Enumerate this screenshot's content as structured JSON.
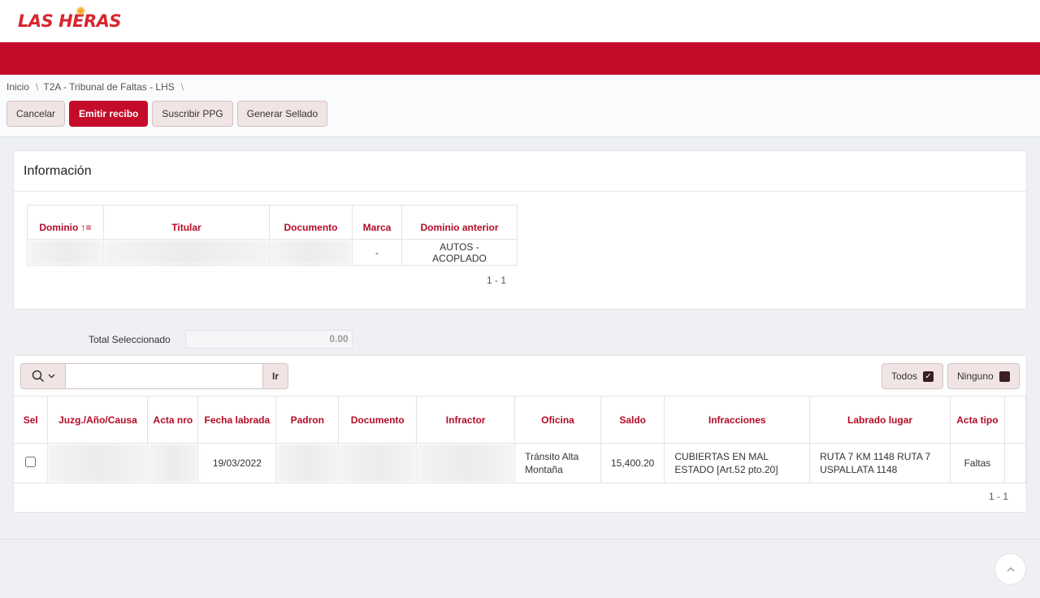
{
  "header": {
    "logo_text": "LAS HERAS",
    "brand_color": "#c40c2a"
  },
  "breadcrumb": [
    "Inicio",
    "T2A - Tribunal de Faltas - LHS"
  ],
  "breadcrumb_separator": "\\",
  "toolbar": {
    "cancel_label": "Cancelar",
    "emit_label": "Emitir recibo",
    "subscribe_label": "Suscribir PPG",
    "seal_label": "Generar Sellado"
  },
  "info": {
    "title": "Información",
    "columns": [
      "Dominio",
      "Titular",
      "Documento",
      "Marca",
      "Dominio anterior"
    ],
    "row": {
      "marca": "-",
      "dominio_anterior": "AUTOS - ACOPLADO"
    },
    "pagination": "1 - 1"
  },
  "total": {
    "label": "Total Seleccionado",
    "value": "0.00"
  },
  "grid": {
    "go_label": "Ir",
    "todos_label": "Todos",
    "ninguno_label": "Ninguno",
    "columns": {
      "sel": "Sel",
      "causa": "Juzg./Año/Causa",
      "acta_nro": "Acta nro",
      "fecha": "Fecha labrada",
      "padron": "Padron",
      "documento": "Documento",
      "infractor": "Infractor",
      "oficina": "Oficina",
      "saldo": "Saldo",
      "infracciones": "Infracciones",
      "lugar": "Labrado lugar",
      "acta_tipo": "Acta tipo"
    },
    "row": {
      "fecha": "19/03/2022",
      "oficina": "Tránsito Alta Montaña",
      "saldo": "15,400.20",
      "infracciones": "CUBIERTAS EN MAL ESTADO [Art.52 pto.20]",
      "lugar": "RUTA 7 KM 1148 RUTA 7 USPALLATA 1148",
      "acta_tipo": "Faltas"
    },
    "pagination": "1 - 1"
  },
  "icons": {
    "search": "search-icon",
    "sort": "sort-asc-icon",
    "scroll_top": "chevron-up-icon"
  }
}
